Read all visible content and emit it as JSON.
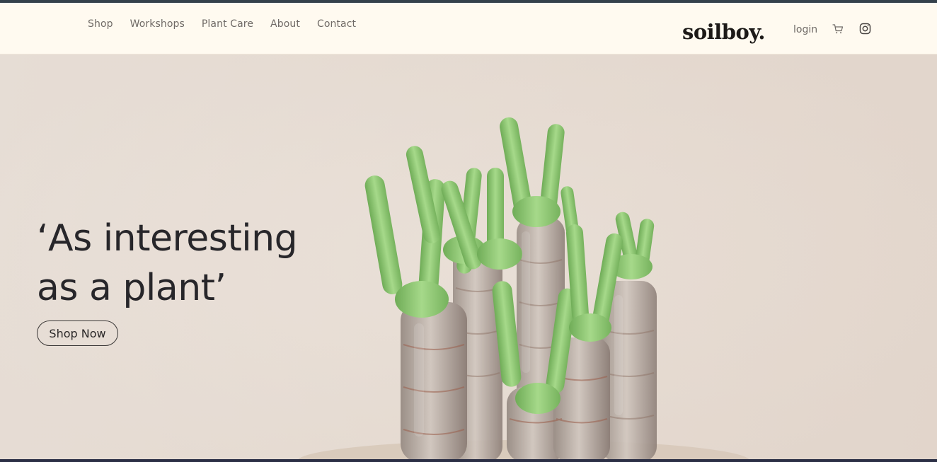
{
  "nav": {
    "links": [
      "Shop",
      "Workshops",
      "Plant Care",
      "About",
      "Contact"
    ],
    "logo": "soilboy.",
    "login": "login",
    "icons": [
      "cart-icon",
      "instagram-icon"
    ]
  },
  "hero": {
    "headline_line1": "‘As interesting",
    "headline_line2": "as a plant’",
    "cta": "Shop Now"
  },
  "colors": {
    "nav_bg": "#fffaf0",
    "hero_bg": "#e6dcd3",
    "text_dark": "#27262a",
    "plant_green": "#8cc56f"
  }
}
